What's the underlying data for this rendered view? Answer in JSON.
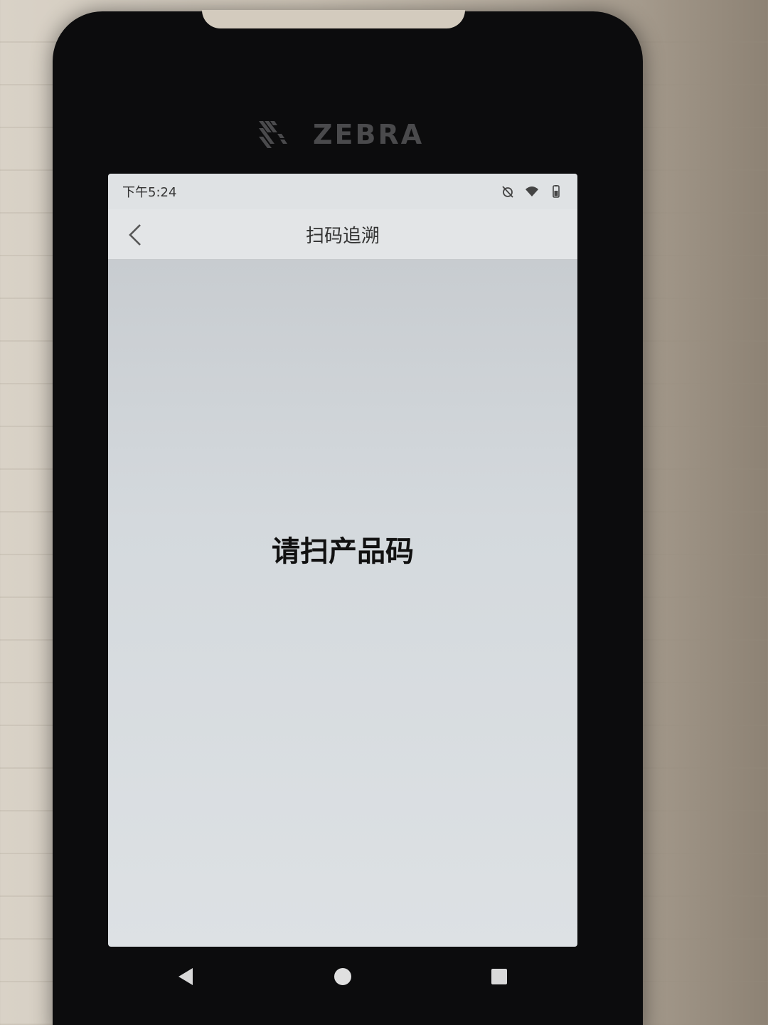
{
  "device": {
    "brand": "ZEBRA"
  },
  "status_bar": {
    "time": "下午5:24",
    "icons": [
      "alarm-off-icon",
      "wifi-icon",
      "battery-icon"
    ]
  },
  "header": {
    "back_icon": "chevron-left-icon",
    "title": "扫码追溯"
  },
  "main": {
    "prompt": "请扫产品码"
  },
  "nav_bar": {
    "icons": [
      "back-triangle-icon",
      "home-circle-icon",
      "recents-square-icon"
    ]
  },
  "colors": {
    "screen_bg": "#d4d9dd",
    "header_bg": "#e3e5e7",
    "device_body": "#0c0c0d"
  }
}
